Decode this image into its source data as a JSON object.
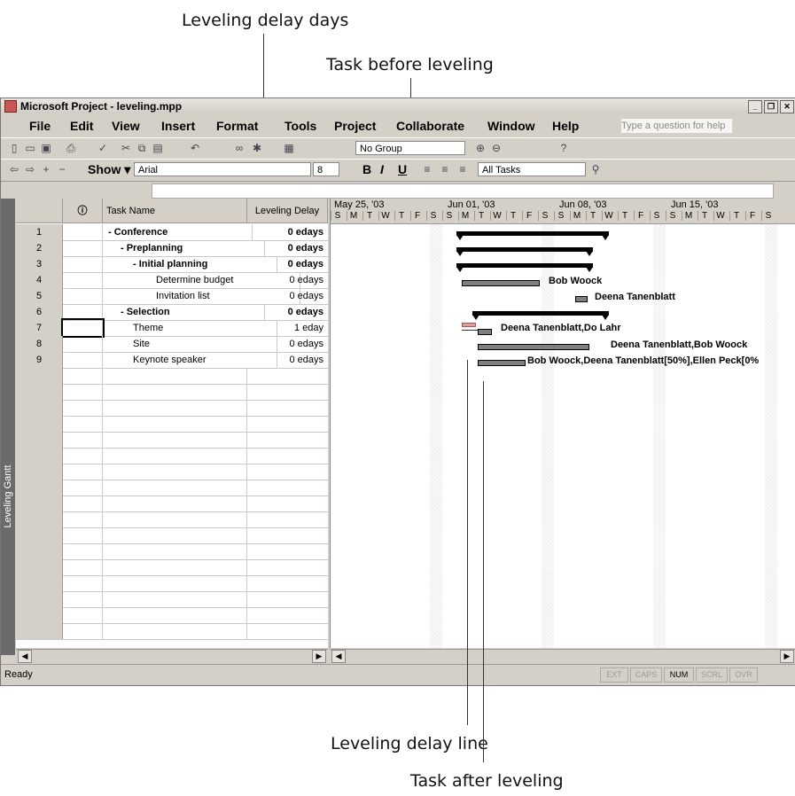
{
  "callouts": {
    "leveling_delay_days": "Leveling delay days",
    "task_before_leveling": "Task before leveling",
    "leveling_delay_line": "Leveling delay line",
    "task_after_leveling": "Task after leveling"
  },
  "window": {
    "title": "Microsoft Project - leveling.mpp",
    "help_placeholder": "Type a question for help"
  },
  "menu": [
    "File",
    "Edit",
    "View",
    "Insert",
    "Format",
    "Tools",
    "Project",
    "Collaborate",
    "Window",
    "Help"
  ],
  "toolbar": {
    "group_select": "No Group",
    "show_label": "Show",
    "font_select": "Arial",
    "size_select": "8",
    "filter_select": "All Tasks"
  },
  "view_bar_label": "Leveling Gantt",
  "table": {
    "headers": {
      "indicators": "ⓘ",
      "name": "Task Name",
      "delay": "Leveling Delay"
    },
    "rows": [
      {
        "id": "1",
        "name": "- Conference",
        "delay": "0 edays",
        "bold": true,
        "indent": 0
      },
      {
        "id": "2",
        "name": "- Preplanning",
        "delay": "0 edays",
        "bold": true,
        "indent": 1
      },
      {
        "id": "3",
        "name": "- Initial planning",
        "delay": "0 edays",
        "bold": true,
        "indent": 2
      },
      {
        "id": "4",
        "name": "Determine budget",
        "delay": "0 edays",
        "bold": false,
        "indent": 3
      },
      {
        "id": "5",
        "name": "Invitation list",
        "delay": "0 edays",
        "bold": false,
        "indent": 3
      },
      {
        "id": "6",
        "name": "- Selection",
        "delay": "0 edays",
        "bold": true,
        "indent": 1
      },
      {
        "id": "7",
        "name": "Theme",
        "delay": "1 eday",
        "bold": false,
        "indent": 2
      },
      {
        "id": "8",
        "name": "Site",
        "delay": "0 edays",
        "bold": false,
        "indent": 2
      },
      {
        "id": "9",
        "name": "Keynote speaker",
        "delay": "0 edays",
        "bold": false,
        "indent": 2
      }
    ]
  },
  "gantt": {
    "weeks": [
      "May 25, '03",
      "Jun 01, '03",
      "Jun 08, '03",
      "Jun 15, '03"
    ],
    "days": [
      "S",
      "M",
      "T",
      "W",
      "T",
      "F",
      "S"
    ],
    "resources": {
      "r4": "Bob Woock",
      "r5": "Deena Tanenblatt",
      "r7": "Deena Tanenblatt,Do Lahr",
      "r8": "Deena Tanenblatt,Bob Woock",
      "r9": "Bob Woock,Deena Tanenblatt[50%],Ellen Peck[0%"
    }
  },
  "status": {
    "ready": "Ready",
    "indicators": [
      "EXT",
      "CAPS",
      "NUM",
      "SCRL",
      "OVR"
    ],
    "active": "NUM"
  }
}
